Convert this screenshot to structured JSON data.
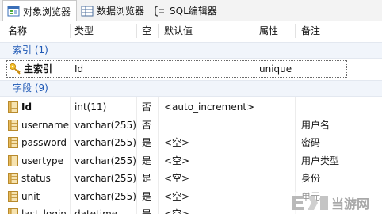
{
  "tabs": [
    {
      "label": "对象浏览器",
      "icon": "object-browser-icon",
      "active": true
    },
    {
      "label": "数据浏览器",
      "icon": "data-browser-icon",
      "active": false
    },
    {
      "label": "SQL编辑器",
      "icon": "sql-editor-icon",
      "active": false
    }
  ],
  "columns": {
    "name": "名称",
    "type": "类型",
    "nullable": "空",
    "default": "默认值",
    "attribute": "属性",
    "note": "备注"
  },
  "index_group": {
    "label": "索引 (1)"
  },
  "indexes": [
    {
      "name": "主索引",
      "type": "Id",
      "attribute": "unique",
      "icon": "key-icon"
    }
  ],
  "field_group": {
    "label": "字段 (9)"
  },
  "fields": [
    {
      "name": "Id",
      "type": "int(11)",
      "nullable": "否",
      "default": "<auto_increment>",
      "note": ""
    },
    {
      "name": "username",
      "type": "varchar(255)",
      "nullable": "否",
      "default": "",
      "note": "用户名"
    },
    {
      "name": "password",
      "type": "varchar(255)",
      "nullable": "是",
      "default": "<空>",
      "note": "密码"
    },
    {
      "name": "usertype",
      "type": "varchar(255)",
      "nullable": "是",
      "default": "<空>",
      "note": "用户类型"
    },
    {
      "name": "status",
      "type": "varchar(255)",
      "nullable": "是",
      "default": "<空>",
      "note": "身份"
    },
    {
      "name": "unit",
      "type": "varchar(255)",
      "nullable": "是",
      "default": "<空>",
      "note": "单元"
    },
    {
      "name": "last_login",
      "type": "datetime",
      "nullable": "是",
      "default": "<空>",
      "note": ""
    }
  ],
  "watermark": {
    "text": "当游网"
  },
  "colors": {
    "group_text": "#1e58b5",
    "group_bg": "#f1f5fb",
    "key_icon": "#e0a21a"
  }
}
